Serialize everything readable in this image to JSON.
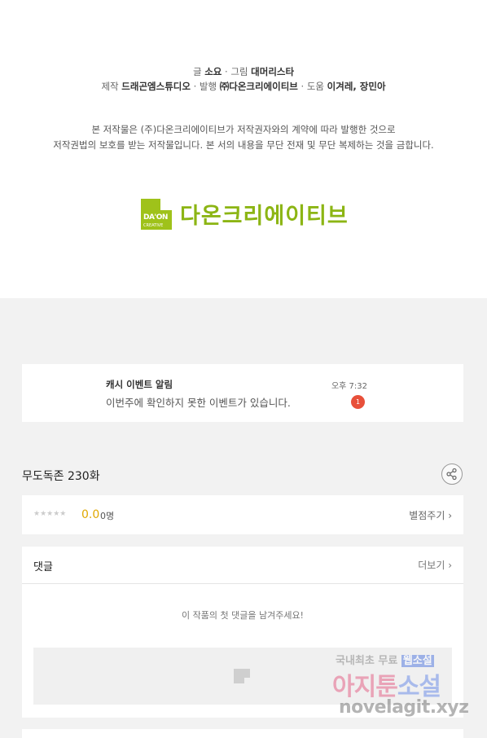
{
  "credits": {
    "line1_prefix": "글",
    "writer": "소요",
    "art_prefix": "· 그림",
    "artist": "대머리스타",
    "line2_prefix": "제작",
    "producer": "드래곤엠스튜디오",
    "publish_prefix": "· 발행",
    "publisher": "㈜다온크리에이티브",
    "help_prefix": "· 도움",
    "helpers": "이겨레, 장민아",
    "copyright_1": "본 저작물은 (주)다온크리에이티브가 저작권자와의 계약에 따라 발행한 것으로",
    "copyright_2": "저작권법의 보호를 받는 저작물입니다. 본 서의 내용을 무단 전재 및 무단 복제하는 것을 금합니다."
  },
  "logo": {
    "mark_text": "DA'ON",
    "mark_sub": "CREATIVE",
    "name": "다온크리에이티브",
    "color": "#8cb514"
  },
  "notice": {
    "title": "캐시 이벤트 알림",
    "message": "이번주에 확인하지 못한 이벤트가 있습니다.",
    "time": "오후 7:32",
    "badge_count": "1"
  },
  "episode": {
    "title": "무도독존 230화",
    "share_icon": "share-icon"
  },
  "rating": {
    "stars": "★★★★★",
    "score": "0.0",
    "raters": "0명",
    "rate_link": "별점주기 ›"
  },
  "comments": {
    "heading": "댓글",
    "more_link": "더보기 ›",
    "empty_message": "이 작품의 첫 댓글을 남겨주세요!"
  },
  "watermark": {
    "line1": "국내최초 무료",
    "line1_tag": "웹소설",
    "line2a": "아지툰",
    "line2b": "소설",
    "line3": "novelagit.xyz"
  }
}
